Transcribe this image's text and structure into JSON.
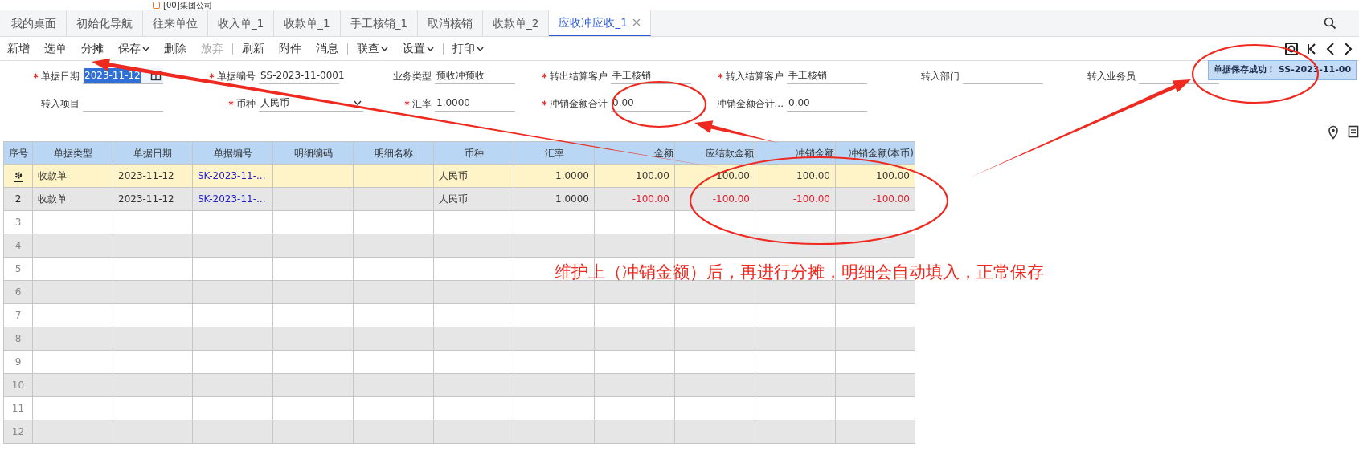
{
  "company": {
    "title": "[00]集团公司"
  },
  "tabs": [
    {
      "label": "我的桌面",
      "selected": false,
      "closable": false
    },
    {
      "label": "初始化导航",
      "selected": false,
      "closable": false
    },
    {
      "label": "往来单位",
      "selected": false,
      "closable": false
    },
    {
      "label": "收入单_1",
      "selected": false,
      "closable": false
    },
    {
      "label": "收款单_1",
      "selected": false,
      "closable": false
    },
    {
      "label": "手工核销_1",
      "selected": false,
      "closable": false
    },
    {
      "label": "取消核销",
      "selected": false,
      "closable": false
    },
    {
      "label": "收款单_2",
      "selected": false,
      "closable": false
    },
    {
      "label": "应收冲应收_1",
      "selected": true,
      "closable": true
    }
  ],
  "toolbar": [
    {
      "kind": "button",
      "label": "新增",
      "disabled": false,
      "dropdown": false
    },
    {
      "kind": "button",
      "label": "选单",
      "disabled": false,
      "dropdown": false
    },
    {
      "kind": "button",
      "label": "分摊",
      "disabled": false,
      "dropdown": false
    },
    {
      "kind": "button",
      "label": "保存",
      "disabled": false,
      "dropdown": true
    },
    {
      "kind": "button",
      "label": "删除",
      "disabled": false,
      "dropdown": false
    },
    {
      "kind": "button",
      "label": "放弃",
      "disabled": true,
      "dropdown": false
    },
    {
      "kind": "separator"
    },
    {
      "kind": "button",
      "label": "刷新",
      "disabled": false,
      "dropdown": false
    },
    {
      "kind": "button",
      "label": "附件",
      "disabled": false,
      "dropdown": false
    },
    {
      "kind": "button",
      "label": "消息",
      "disabled": false,
      "dropdown": false
    },
    {
      "kind": "separator"
    },
    {
      "kind": "button",
      "label": "联查",
      "disabled": false,
      "dropdown": true
    },
    {
      "kind": "button",
      "label": "设置",
      "disabled": false,
      "dropdown": true
    },
    {
      "kind": "separator"
    },
    {
      "kind": "button",
      "label": "打印",
      "disabled": false,
      "dropdown": true
    }
  ],
  "form_rows": [
    [
      {
        "label": "单据日期",
        "value": "2023-11-12",
        "required": true,
        "kind": "date",
        "highlighted": true
      },
      {
        "label": "单据编号",
        "value": "SS-2023-11-0001",
        "required": true,
        "kind": "text",
        "highlighted": false
      },
      {
        "label": "业务类型",
        "value": "预收冲预收",
        "required": false,
        "kind": "text",
        "highlighted": false
      },
      {
        "label": "转出结算客户",
        "value": "手工核销",
        "required": true,
        "kind": "text",
        "highlighted": false
      },
      {
        "label": "转入结算客户",
        "value": "手工核销",
        "required": true,
        "kind": "text",
        "highlighted": false
      },
      {
        "label": "转入部门",
        "required": false,
        "kind": "text",
        "highlighted": false
      },
      {
        "label": "转入业务员",
        "required": false,
        "kind": "text",
        "highlighted": false
      }
    ],
    [
      {
        "label": "转入项目",
        "required": false,
        "kind": "text",
        "highlighted": false
      },
      {
        "label": "币种",
        "value": "人民币",
        "required": true,
        "kind": "select",
        "highlighted": false
      },
      {
        "label": "汇率",
        "value": "1.0000",
        "required": true,
        "kind": "text",
        "highlighted": false
      },
      {
        "label": "冲销金额合计",
        "value": "0.00",
        "required": true,
        "kind": "text",
        "highlighted": false
      },
      {
        "label": "冲销金额合计...",
        "value": "0.00",
        "required": false,
        "kind": "text",
        "highlighted": false
      }
    ]
  ],
  "toast": {
    "text": "单据保存成功！ SS-2023-11-00"
  },
  "table": {
    "columns": [
      {
        "label": "序号",
        "kind": "index"
      },
      {
        "label": "单据类型",
        "kind": "text"
      },
      {
        "label": "单据日期",
        "kind": "text"
      },
      {
        "label": "单据编号",
        "kind": "link"
      },
      {
        "label": "明细编码",
        "kind": "text"
      },
      {
        "label": "明细名称",
        "kind": "text"
      },
      {
        "label": "币种",
        "kind": "text"
      },
      {
        "label": "汇率",
        "kind": "number"
      },
      {
        "label": "金额",
        "kind": "amount"
      },
      {
        "label": "应结款金额",
        "kind": "amount"
      },
      {
        "label": "冲销金额",
        "kind": "amount"
      },
      {
        "label": "冲销金额(本币)",
        "kind": "amount"
      }
    ],
    "rows": [
      {
        "selected": true,
        "negative": false,
        "cells": [
          null,
          "收款单",
          "2023-11-12",
          "SK-2023-11-...",
          null,
          null,
          "人民币",
          "1.0000",
          "100.00",
          "100.00",
          "100.00",
          "100.00"
        ]
      },
      {
        "selected": false,
        "negative": true,
        "cells": [
          "2",
          "收款单",
          "2023-11-12",
          "SK-2023-11-...",
          null,
          null,
          "人民币",
          "1.0000",
          "-100.00",
          "-100.00",
          "-100.00",
          "-100.00"
        ]
      },
      {
        "selected": false,
        "cells": [
          "3"
        ]
      },
      {
        "selected": false,
        "cells": [
          "4"
        ]
      },
      {
        "selected": false,
        "cells": [
          "5"
        ]
      },
      {
        "selected": false,
        "cells": [
          "6"
        ]
      },
      {
        "selected": false,
        "cells": [
          "7"
        ]
      },
      {
        "selected": false,
        "cells": [
          "8"
        ]
      },
      {
        "selected": false,
        "cells": [
          "9"
        ]
      },
      {
        "selected": false,
        "cells": [
          "10"
        ]
      },
      {
        "selected": false,
        "cells": [
          "11"
        ]
      },
      {
        "selected": false,
        "cells": [
          "12"
        ]
      }
    ]
  },
  "annotation": {
    "text": "维护上（冲销金额）后，再进行分摊，明细会自动填入，正常保存"
  }
}
